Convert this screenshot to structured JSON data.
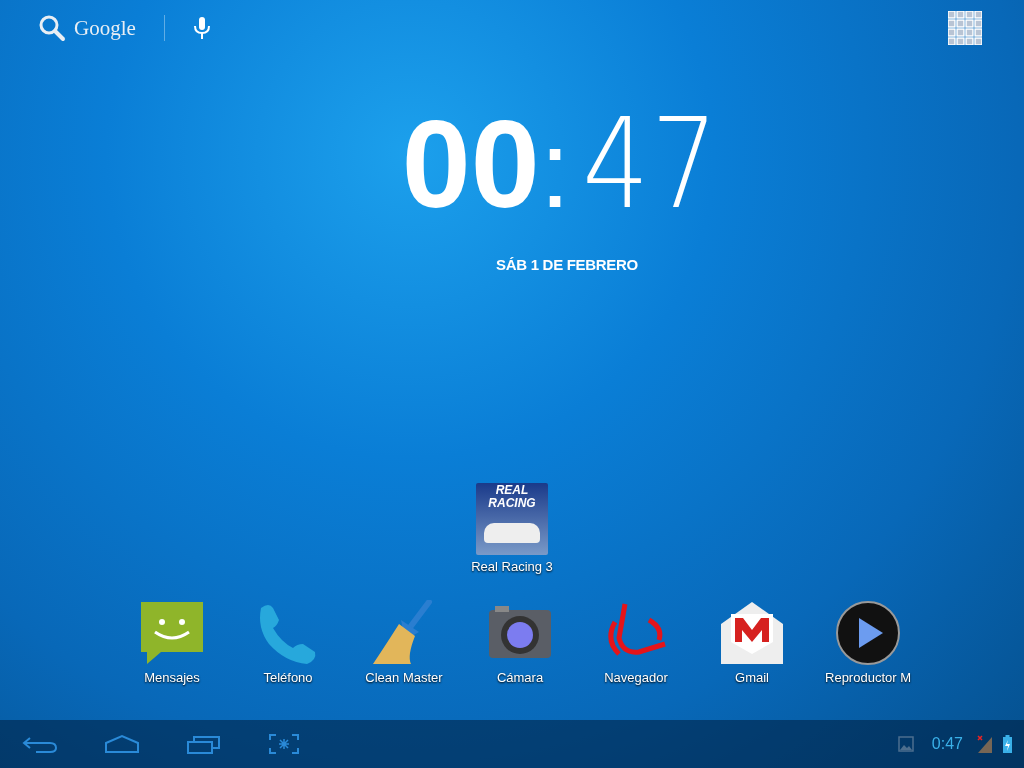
{
  "search": {
    "label": "Google"
  },
  "clock": {
    "hours": "00",
    "separator": ":",
    "minutes": "47"
  },
  "date": "SÁB 1 DE FEBRERO",
  "desktop_apps": [
    {
      "label": "Real Racing 3",
      "kind": "racing",
      "icon_text": [
        "REAL",
        "RACING"
      ]
    }
  ],
  "dock_apps": [
    {
      "label": "Mensajes",
      "kind": "messages"
    },
    {
      "label": "Teléfono",
      "kind": "phone"
    },
    {
      "label": "Clean Master",
      "kind": "broom"
    },
    {
      "label": "Cámara",
      "kind": "camera"
    },
    {
      "label": "Navegador",
      "kind": "browser"
    },
    {
      "label": "Gmail",
      "kind": "mail"
    },
    {
      "label": "Reproductor M",
      "kind": "player"
    }
  ],
  "status_bar": {
    "time": "0:47"
  }
}
